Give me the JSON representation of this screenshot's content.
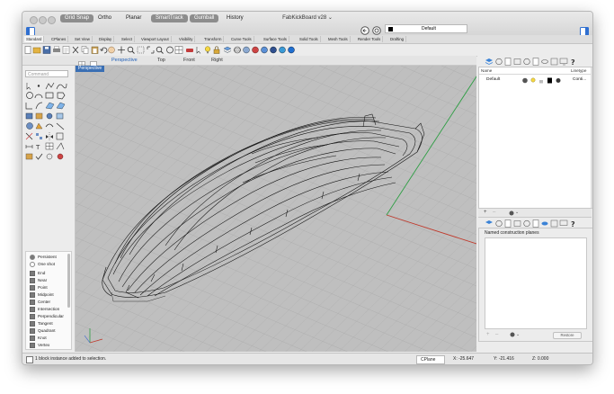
{
  "window": {
    "title": "FabKickBoard v28",
    "title_chevron": "⌄",
    "toggles": [
      {
        "label": "Grid Snap",
        "active": true
      },
      {
        "label": "Ortho",
        "active": false
      },
      {
        "label": "Planar",
        "active": false
      },
      {
        "label": "SmartTrack",
        "active": true
      },
      {
        "label": "Gumball",
        "active": true
      },
      {
        "label": "History",
        "active": false
      }
    ],
    "default_layer": "Default"
  },
  "tabs": [
    "Standard",
    "CPlanes",
    "Set View",
    "Display",
    "Select",
    "Viewport Layout",
    "Visibility",
    "Transform",
    "Curve Tools",
    "Surface Tools",
    "Solid Tools",
    "Mesh Tools",
    "Render Tools",
    "Drafting"
  ],
  "viewport_tabs": [
    "Perspective",
    "Top",
    "Front",
    "Right"
  ],
  "viewport": {
    "label": "Perspective"
  },
  "command": {
    "placeholder": "Command"
  },
  "osnap": {
    "modes": [
      {
        "label": "Persistent",
        "selected": true
      },
      {
        "label": "One shot",
        "selected": false
      }
    ],
    "items": [
      {
        "label": "End",
        "checked": true
      },
      {
        "label": "Near",
        "checked": true
      },
      {
        "label": "Point",
        "checked": true
      },
      {
        "label": "Midpoint",
        "checked": true
      },
      {
        "label": "Center",
        "checked": true
      },
      {
        "label": "Intersection",
        "checked": true
      },
      {
        "label": "Perpendicular",
        "checked": true
      },
      {
        "label": "Tangent",
        "checked": true
      },
      {
        "label": "Quadrant",
        "checked": true
      },
      {
        "label": "Knot",
        "checked": true
      },
      {
        "label": "Vertex",
        "checked": true
      }
    ]
  },
  "layers": {
    "header_name": "Name",
    "header_linetype": "Linetype",
    "row_name": "Default",
    "row_linetype": "Conti..."
  },
  "layer_bar": {
    "add": "+",
    "remove": "–",
    "options": "⌄"
  },
  "cplanes": {
    "title": "Named construction planes",
    "restore": "Restore"
  },
  "status": {
    "message": "1 block instance added to selection.",
    "cplane": "CPlane",
    "x": "X: -25.647",
    "y": "Y: -21.416",
    "z": "Z: 0.000"
  },
  "colors": {
    "accent": "#3a6fb4",
    "toggle_bg": "#8d8d8d",
    "x_axis": "#c0392b",
    "y_axis": "#2e9e44"
  }
}
